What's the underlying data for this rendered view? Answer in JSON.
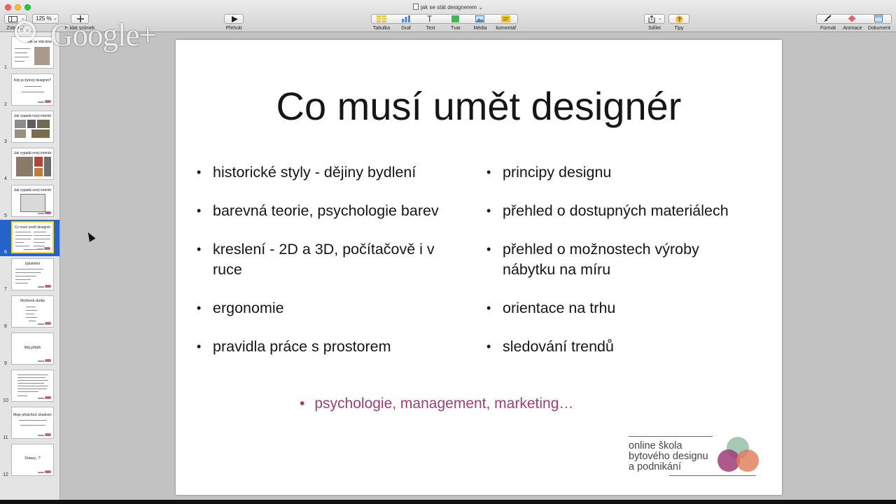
{
  "window": {
    "title": "jak se stát designerem",
    "title_chevron": "⌄"
  },
  "toolbar": {
    "view_label": "Zobrazit",
    "zoom_value": "125 %",
    "add_slide_label": "Přidat snímek",
    "play_label": "Přehrát",
    "table_label": "Tabulka",
    "chart_label": "Graf",
    "text_label": "Text",
    "shape_label": "Tvar",
    "media_label": "Média",
    "comment_label": "komentář",
    "share_label": "Sdílet",
    "tips_label": "Tipy",
    "format_label": "Formát",
    "animate_label": "Animace",
    "document_label": "Dokument"
  },
  "watermark": {
    "text": "Google+"
  },
  "slides": [
    {
      "number": "1",
      "title": "Jak se stát designérem?"
    },
    {
      "number": "2",
      "title": "Kdo je bytový designér?"
    },
    {
      "number": "3",
      "title": "Jak vypadá nový interiér"
    },
    {
      "number": "4",
      "title": "Jak vypadá nový interiér"
    },
    {
      "number": "5",
      "title": "Jak vypadá nový interiér"
    },
    {
      "number": "6",
      "title": "Co musí umět designér",
      "selected": true
    },
    {
      "number": "7",
      "title": "Uplatnění"
    },
    {
      "number": "8",
      "title": "Možnosti studia"
    },
    {
      "number": "9",
      "title": "Můj příběh"
    },
    {
      "number": "10",
      "title": ""
    },
    {
      "number": "11",
      "title": "Moje předchozí zkušenosti..."
    },
    {
      "number": "12",
      "title": "Dotazy...?"
    }
  ],
  "current_slide": {
    "title": "Co musí umět designér",
    "left_bullets": [
      "historické styly - dějiny bydlení",
      "barevná teorie, psychologie barev",
      "kreslení - 2D a 3D, počítačově i v ruce",
      "ergonomie",
      "pravidla práce s prostorem"
    ],
    "right_bullets": [
      "principy designu",
      "přehled o dostupných materiálech",
      "přehled o možnostech výroby nábytku na míru",
      "orientace na trhu",
      "sledování trendů"
    ],
    "sub_bullet": "psychologie, management, marketing…",
    "logo_lines": [
      "online škola",
      "bytového designu",
      "a podnikání"
    ]
  },
  "colors": {
    "accent_purple": "#9d3f75",
    "selection_blue": "#2463c9",
    "selection_yellow": "#f4d42c",
    "logo_line": "#b8494b",
    "logo_green": "#9cc3ad",
    "logo_purple": "#9e3d78",
    "logo_orange": "#e07a57"
  }
}
